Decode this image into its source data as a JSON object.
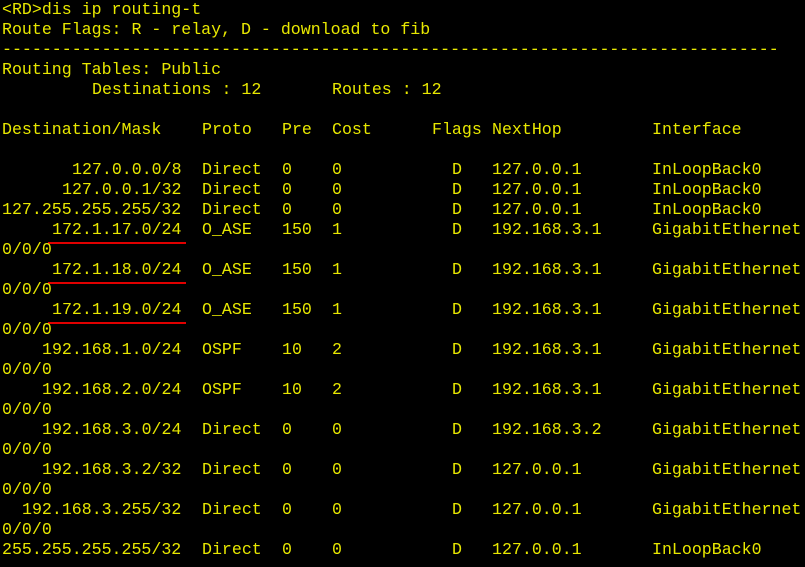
{
  "prompt": "<RD>",
  "command": "dis ip routing-t",
  "flags_line": "Route Flags: R - relay, D - download to fib",
  "separator": "------------------------------------------------------------------------------",
  "table_name": "Routing Tables: Public",
  "destinations_label": "Destinations : 12",
  "routes_label": "Routes : 12",
  "headers": {
    "destination": "Destination/Mask",
    "proto": "Proto",
    "pre": "Pre",
    "cost": "Cost",
    "flags": "Flags",
    "nexthop": "NextHop",
    "interface": "Interface"
  },
  "routes": [
    {
      "dest": "127.0.0.0/8",
      "proto": "Direct",
      "pre": "0",
      "cost": "0",
      "flags": "D",
      "nexthop": "127.0.0.1",
      "iface": "InLoopBack0",
      "iface_cont": ""
    },
    {
      "dest": "127.0.0.1/32",
      "proto": "Direct",
      "pre": "0",
      "cost": "0",
      "flags": "D",
      "nexthop": "127.0.0.1",
      "iface": "InLoopBack0",
      "iface_cont": ""
    },
    {
      "dest": "127.255.255.255/32",
      "proto": "Direct",
      "pre": "0",
      "cost": "0",
      "flags": "D",
      "nexthop": "127.0.0.1",
      "iface": "InLoopBack0",
      "iface_cont": ""
    },
    {
      "dest": "172.1.17.0/24",
      "proto": "O_ASE",
      "pre": "150",
      "cost": "1",
      "flags": "D",
      "nexthop": "192.168.3.1",
      "iface": "GigabitEthernet",
      "iface_cont": "0/0/0",
      "highlight": true
    },
    {
      "dest": "172.1.18.0/24",
      "proto": "O_ASE",
      "pre": "150",
      "cost": "1",
      "flags": "D",
      "nexthop": "192.168.3.1",
      "iface": "GigabitEthernet",
      "iface_cont": "0/0/0",
      "highlight": true
    },
    {
      "dest": "172.1.19.0/24",
      "proto": "O_ASE",
      "pre": "150",
      "cost": "1",
      "flags": "D",
      "nexthop": "192.168.3.1",
      "iface": "GigabitEthernet",
      "iface_cont": "0/0/0",
      "highlight": true
    },
    {
      "dest": "192.168.1.0/24",
      "proto": "OSPF",
      "pre": "10",
      "cost": "2",
      "flags": "D",
      "nexthop": "192.168.3.1",
      "iface": "GigabitEthernet",
      "iface_cont": "0/0/0"
    },
    {
      "dest": "192.168.2.0/24",
      "proto": "OSPF",
      "pre": "10",
      "cost": "2",
      "flags": "D",
      "nexthop": "192.168.3.1",
      "iface": "GigabitEthernet",
      "iface_cont": "0/0/0"
    },
    {
      "dest": "192.168.3.0/24",
      "proto": "Direct",
      "pre": "0",
      "cost": "0",
      "flags": "D",
      "nexthop": "192.168.3.2",
      "iface": "GigabitEthernet",
      "iface_cont": "0/0/0"
    },
    {
      "dest": "192.168.3.2/32",
      "proto": "Direct",
      "pre": "0",
      "cost": "0",
      "flags": "D",
      "nexthop": "127.0.0.1",
      "iface": "GigabitEthernet",
      "iface_cont": "0/0/0"
    },
    {
      "dest": "192.168.3.255/32",
      "proto": "Direct",
      "pre": "0",
      "cost": "0",
      "flags": "D",
      "nexthop": "127.0.0.1",
      "iface": "GigabitEthernet",
      "iface_cont": "0/0/0"
    },
    {
      "dest": "255.255.255.255/32",
      "proto": "Direct",
      "pre": "0",
      "cost": "0",
      "flags": "D",
      "nexthop": "127.0.0.1",
      "iface": "InLoopBack0",
      "iface_cont": ""
    }
  ],
  "colors": {
    "background": "#000000",
    "text": "#e8e800",
    "highlight_underline": "#e00000"
  }
}
